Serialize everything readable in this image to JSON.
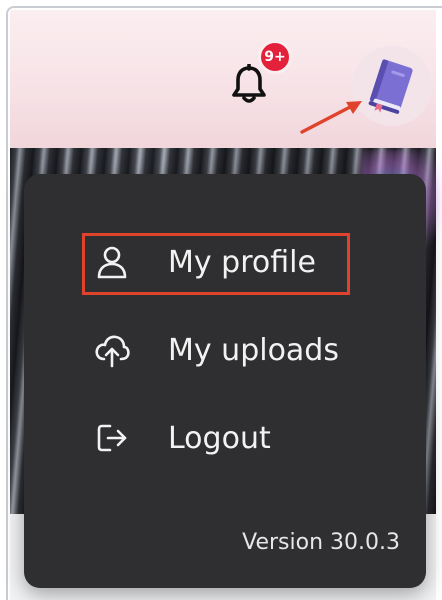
{
  "header": {
    "notifications": {
      "icon": "bell-icon",
      "badge_text": "9+",
      "badge_color": "#e4213b"
    },
    "avatar": {
      "icon": "book-icon"
    }
  },
  "annotation": {
    "arrow_color": "#e0432c",
    "highlight_color": "#e0432c"
  },
  "menu": {
    "items": [
      {
        "label": "My profile",
        "icon": "user-icon"
      },
      {
        "label": "My uploads",
        "icon": "cloud-upload-icon"
      },
      {
        "label": "Logout",
        "icon": "logout-icon"
      }
    ],
    "version": "Version 30.0.3",
    "background": "#2f2f31"
  }
}
